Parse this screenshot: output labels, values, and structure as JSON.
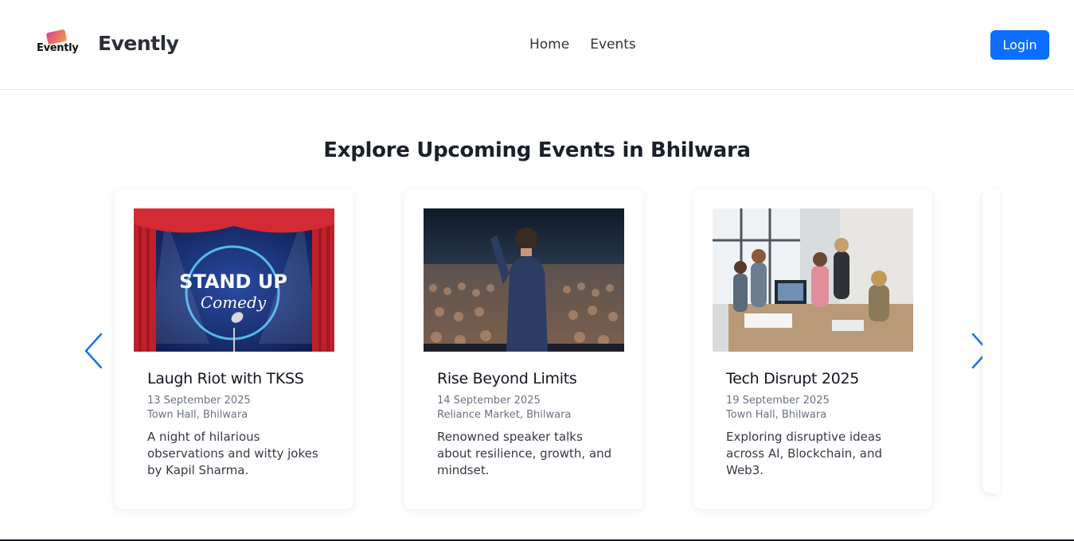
{
  "header": {
    "logo_text": "Evently",
    "brand": "Evently",
    "nav": [
      "Home",
      "Events"
    ],
    "login_label": "Login"
  },
  "section": {
    "heading": "Explore Upcoming Events in Bhilwara"
  },
  "events": [
    {
      "title": "Laugh Riot with TKSS",
      "date": "13 September 2025",
      "venue": "Town Hall, Bhilwara",
      "description": "A night of hilarious observations and witty jokes by Kapil Sharma.",
      "poster_line1": "STAND UP",
      "poster_line2": "Comedy"
    },
    {
      "title": "Rise Beyond Limits",
      "date": "14 September 2025",
      "venue": "Reliance Market, Bhilwara",
      "description": "Renowned speaker talks about resilience, growth, and mindset."
    },
    {
      "title": "Tech Disrupt 2025",
      "date": "19 September 2025",
      "venue": "Town Hall, Bhilwara",
      "description": "Exploring disruptive ideas across AI, Blockchain, and Web3."
    }
  ],
  "colors": {
    "accent": "#0d6efd",
    "arrow": "#1a73e8"
  },
  "icons": {
    "prev": "chevron-left-icon",
    "next": "chevron-right-icon"
  }
}
